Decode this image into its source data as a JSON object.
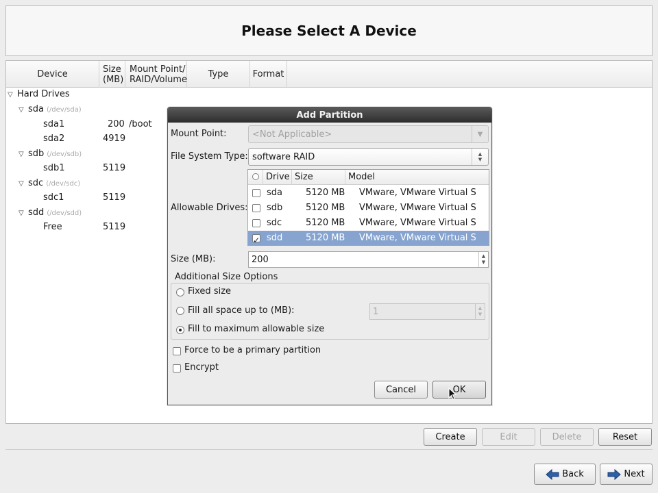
{
  "title": "Please Select A Device",
  "tree": {
    "columns": [
      "Device",
      "Size (MB)",
      "Mount Point/ RAID/Volume",
      "Type",
      "Format"
    ],
    "col_size_l1": "Size",
    "col_size_l2": "(MB)",
    "col_mount_l1": "Mount Point/",
    "col_mount_l2": "RAID/Volume",
    "hard_drives": "Hard Drives",
    "rows": [
      {
        "name": "sda",
        "dev": "(/dev/sda)"
      },
      {
        "name": "sda1",
        "size": "200",
        "mount": "/boot"
      },
      {
        "name": "sda2",
        "size": "4919"
      },
      {
        "name": "sdb",
        "dev": "(/dev/sdb)"
      },
      {
        "name": "sdb1",
        "size": "5119"
      },
      {
        "name": "sdc",
        "dev": "(/dev/sdc)"
      },
      {
        "name": "sdc1",
        "size": "5119"
      },
      {
        "name": "sdd",
        "dev": "(/dev/sdd)"
      },
      {
        "name": "Free",
        "size": "5119"
      }
    ]
  },
  "actions": {
    "create": "Create",
    "edit": "Edit",
    "delete": "Delete",
    "reset": "Reset"
  },
  "nav": {
    "back": "Back",
    "next": "Next"
  },
  "dialog": {
    "title": "Add Partition",
    "mount_point_label": "Mount Point:",
    "mount_point_value": "<Not Applicable>",
    "fs_type_label": "File System Type:",
    "fs_type_value": "software RAID",
    "allowable_drives_label": "Allowable Drives:",
    "drives_columns": {
      "drive": "Drive",
      "size": "Size",
      "model": "Model"
    },
    "drives": [
      {
        "drive": "sda",
        "size": "5120 MB",
        "model": "VMware, VMware Virtual S",
        "checked": false
      },
      {
        "drive": "sdb",
        "size": "5120 MB",
        "model": "VMware, VMware Virtual S",
        "checked": false
      },
      {
        "drive": "sdc",
        "size": "5120 MB",
        "model": "VMware, VMware Virtual S",
        "checked": false
      },
      {
        "drive": "sdd",
        "size": "5120 MB",
        "model": "VMware, VMware Virtual S",
        "checked": true
      }
    ],
    "size_label": "Size (MB):",
    "size_value": "200",
    "additional_options_title": "Additional Size Options",
    "opt_fixed": "Fixed size",
    "opt_fill_upto": "Fill all space up to (MB):",
    "opt_fill_upto_value": "1",
    "opt_fill_max": "Fill to maximum allowable size",
    "force_primary": "Force to be a primary partition",
    "encrypt": "Encrypt",
    "cancel": "Cancel",
    "ok": "OK"
  }
}
